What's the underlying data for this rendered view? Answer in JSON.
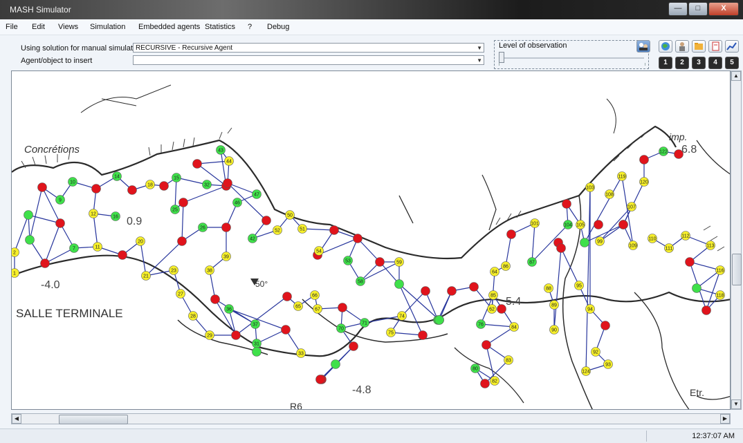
{
  "window": {
    "title": "MASH Simulator",
    "minimize": "—",
    "maximize": "□",
    "close": "X"
  },
  "menu": [
    "File",
    "Edit",
    "Views",
    "Simulation",
    "Embedded agents",
    "Statistics",
    "?",
    "Debug"
  ],
  "controls": {
    "solution_label": "Using solution for manual simulation",
    "solution_value": "RECURSIVE - Recursive Agent",
    "insert_label": "Agent/object to insert",
    "insert_value": "",
    "observation_label": "Level of observation",
    "observation_level": 0
  },
  "toolbar": {
    "icons": [
      "globe-icon",
      "person-icon",
      "folder-icon",
      "document-icon",
      "chart-icon"
    ],
    "levels": [
      "1",
      "2",
      "3",
      "4",
      "5"
    ]
  },
  "map": {
    "labels": {
      "concretions": "Concrétions",
      "salle": "SALLE TERMINALE",
      "imp": "imp.",
      "etr": "Etr.",
      "r6": "R6",
      "v50": "50°",
      "n09": "0.9",
      "n40": "-4.0",
      "n48": "-4.8",
      "n54": "5.4",
      "n68": "6.8"
    },
    "colors": {
      "green": "#3fe04a",
      "yellow": "#f6ef2a",
      "red": "#e0141c",
      "link": "#27359c"
    },
    "nodes": [
      {
        "id": "2",
        "c": "y"
      },
      {
        "id": "1",
        "c": "y"
      },
      {
        "id": "",
        "c": "g"
      },
      {
        "id": "",
        "c": "g"
      },
      {
        "id": "",
        "c": "r"
      },
      {
        "id": "",
        "c": "r"
      },
      {
        "id": "",
        "c": "r"
      },
      {
        "id": "7",
        "c": "g"
      },
      {
        "id": "9",
        "c": "g"
      },
      {
        "id": "10",
        "c": "g"
      },
      {
        "id": "",
        "c": "r"
      },
      {
        "id": "12",
        "c": "y"
      },
      {
        "id": "11",
        "c": "y"
      },
      {
        "id": "",
        "c": "r"
      },
      {
        "id": "14",
        "c": "g"
      },
      {
        "id": "16",
        "c": "g"
      },
      {
        "id": "",
        "c": "r"
      },
      {
        "id": "18",
        "c": "y"
      },
      {
        "id": "",
        "c": "r"
      },
      {
        "id": "20",
        "c": "y"
      },
      {
        "id": "21",
        "c": "y"
      },
      {
        "id": "15",
        "c": "g"
      },
      {
        "id": "25",
        "c": "g"
      },
      {
        "id": "",
        "c": "r"
      },
      {
        "id": "",
        "c": "r"
      },
      {
        "id": "",
        "c": "r"
      },
      {
        "id": "32",
        "c": "g"
      },
      {
        "id": "26",
        "c": "g"
      },
      {
        "id": "23",
        "c": "y"
      },
      {
        "id": "27",
        "c": "y"
      },
      {
        "id": "28",
        "c": "y"
      },
      {
        "id": "29",
        "c": "y"
      },
      {
        "id": "",
        "c": "r"
      },
      {
        "id": "",
        "c": "r"
      },
      {
        "id": "37",
        "c": "g"
      },
      {
        "id": "36",
        "c": "g"
      },
      {
        "id": "31",
        "c": "g"
      },
      {
        "id": "",
        "c": "r"
      },
      {
        "id": "",
        "c": "r"
      },
      {
        "id": "38",
        "c": "y"
      },
      {
        "id": "39",
        "c": "y"
      },
      {
        "id": "43",
        "c": "g"
      },
      {
        "id": "44",
        "c": "y"
      },
      {
        "id": "",
        "c": "r"
      },
      {
        "id": "46",
        "c": "g"
      },
      {
        "id": "47",
        "c": "g"
      },
      {
        "id": "",
        "c": "r"
      },
      {
        "id": "",
        "c": "r"
      },
      {
        "id": "42",
        "c": "g"
      },
      {
        "id": "50",
        "c": "y"
      },
      {
        "id": "52",
        "c": "y"
      },
      {
        "id": "51",
        "c": "y"
      },
      {
        "id": "",
        "c": "r"
      },
      {
        "id": "",
        "c": "r"
      },
      {
        "id": "54",
        "c": "y"
      },
      {
        "id": "",
        "c": "r"
      },
      {
        "id": "53",
        "c": "g"
      },
      {
        "id": "58",
        "c": "g"
      },
      {
        "id": "",
        "c": "r"
      },
      {
        "id": "59",
        "c": "y"
      },
      {
        "id": "",
        "c": "g"
      },
      {
        "id": "",
        "c": "g"
      },
      {
        "id": "65",
        "c": "y"
      },
      {
        "id": "66",
        "c": "y"
      },
      {
        "id": "67",
        "c": "y"
      },
      {
        "id": "",
        "c": "r"
      },
      {
        "id": "",
        "c": "r"
      },
      {
        "id": "",
        "c": "r"
      },
      {
        "id": "70",
        "c": "g"
      },
      {
        "id": "",
        "c": "g"
      },
      {
        "id": "71",
        "c": "g"
      },
      {
        "id": "",
        "c": "r"
      },
      {
        "id": "74",
        "c": "y"
      },
      {
        "id": "75",
        "c": "y"
      },
      {
        "id": "",
        "c": "r"
      },
      {
        "id": "",
        "c": "r"
      },
      {
        "id": "",
        "c": "g"
      },
      {
        "id": "",
        "c": "g"
      },
      {
        "id": "",
        "c": "r"
      },
      {
        "id": "62",
        "c": "y"
      },
      {
        "id": "",
        "c": "r"
      },
      {
        "id": "64",
        "c": "y"
      },
      {
        "id": "86",
        "c": "y"
      },
      {
        "id": "",
        "c": "r"
      },
      {
        "id": "85",
        "c": "y"
      },
      {
        "id": "76",
        "c": "g"
      },
      {
        "id": "84",
        "c": "y"
      },
      {
        "id": "",
        "c": "r"
      },
      {
        "id": "83",
        "c": "y"
      },
      {
        "id": "",
        "c": "r"
      },
      {
        "id": "80",
        "c": "g"
      },
      {
        "id": "82",
        "c": "y"
      },
      {
        "id": "",
        "c": "r"
      },
      {
        "id": "101",
        "c": "y"
      },
      {
        "id": "87",
        "c": "g"
      },
      {
        "id": "88",
        "c": "y"
      },
      {
        "id": "89",
        "c": "y"
      },
      {
        "id": "90",
        "c": "y"
      },
      {
        "id": "",
        "c": "r"
      },
      {
        "id": "104",
        "c": "g"
      },
      {
        "id": "",
        "c": "r"
      },
      {
        "id": "",
        "c": "r"
      },
      {
        "id": "105",
        "c": "y"
      },
      {
        "id": "",
        "c": "g"
      },
      {
        "id": "",
        "c": "r"
      },
      {
        "id": "95",
        "c": "y"
      },
      {
        "id": "94",
        "c": "y"
      },
      {
        "id": "",
        "c": "r"
      },
      {
        "id": "92",
        "c": "y"
      },
      {
        "id": "93",
        "c": "y"
      },
      {
        "id": "124",
        "c": "y"
      },
      {
        "id": "103",
        "c": "y"
      },
      {
        "id": "108",
        "c": "y"
      },
      {
        "id": "107",
        "c": "y"
      },
      {
        "id": "99",
        "c": "y"
      },
      {
        "id": "",
        "c": "r"
      },
      {
        "id": "109",
        "c": "y"
      },
      {
        "id": "119",
        "c": "y"
      },
      {
        "id": "120",
        "c": "y"
      },
      {
        "id": "",
        "c": "r"
      },
      {
        "id": "122",
        "c": "g"
      },
      {
        "id": "",
        "c": "r"
      },
      {
        "id": "110",
        "c": "y"
      },
      {
        "id": "111",
        "c": "y"
      },
      {
        "id": "112",
        "c": "y"
      },
      {
        "id": "113",
        "c": "y"
      },
      {
        "id": "",
        "c": "r"
      },
      {
        "id": "116",
        "c": "y"
      },
      {
        "id": "",
        "c": "g"
      },
      {
        "id": "118",
        "c": "y"
      },
      {
        "id": "",
        "c": "r"
      },
      {
        "id": "",
        "c": "r"
      },
      {
        "id": "33",
        "c": "y"
      },
      {
        "id": "",
        "c": "g"
      },
      {
        "id": "",
        "c": "r"
      }
    ]
  },
  "status": {
    "time": "12:37:07 AM"
  }
}
